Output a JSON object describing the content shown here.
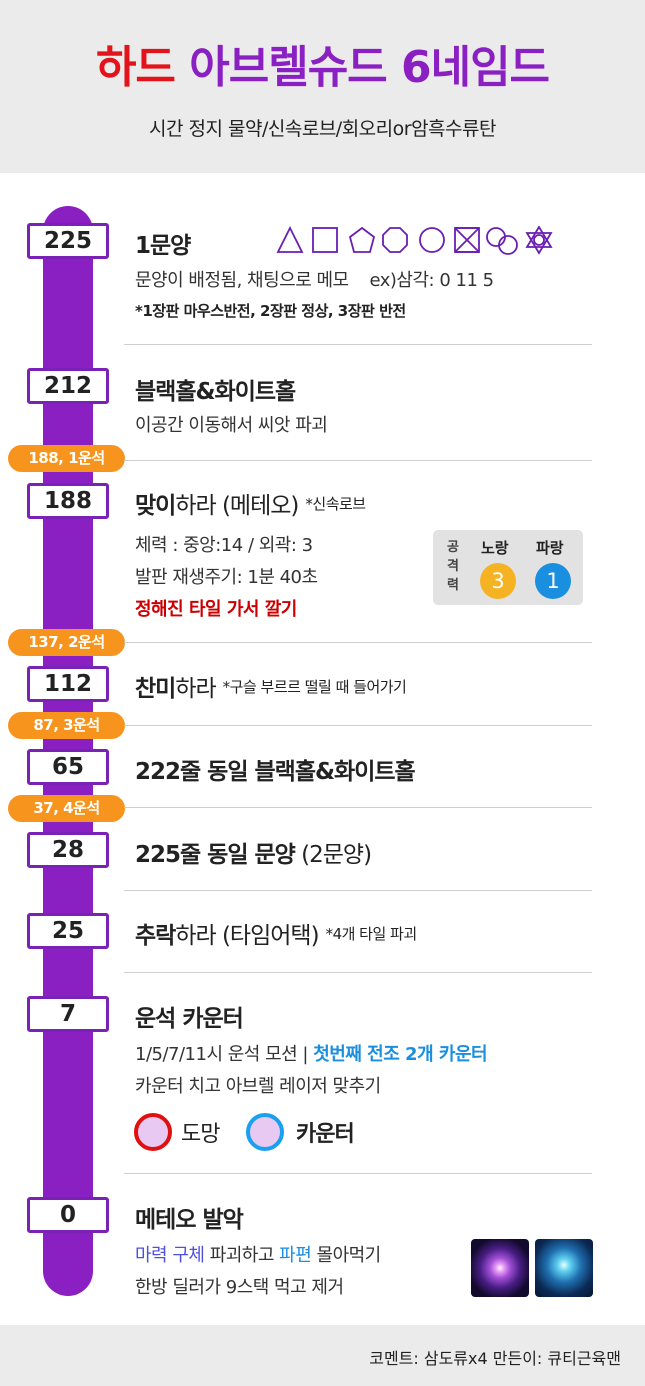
{
  "header": {
    "title_part1": "하드",
    "title_part2": "아브렐슈드 6네임드",
    "subtitle": "시간 정지 물약/신속로브/회오리or암흑수류탄"
  },
  "colors": {
    "timeline": "#8a1fc2",
    "badge": "#f7941d",
    "title_red": "#e3131b",
    "title_purple": "#8a1fc2",
    "yellow_circle": "#f5b324",
    "blue_circle": "#1a8fe0"
  },
  "timeline": [
    {
      "num": "225",
      "badge": ""
    },
    {
      "num": "212",
      "badge": ""
    },
    {
      "num": "188",
      "badge": "188, 1운석"
    },
    {
      "num": "112",
      "badge": "137, 2운석"
    },
    {
      "num": "65",
      "badge": "87, 3운석"
    },
    {
      "num": "28",
      "badge": "37, 4운석"
    },
    {
      "num": "25",
      "badge": ""
    },
    {
      "num": "7",
      "badge": ""
    },
    {
      "num": "0",
      "badge": ""
    }
  ],
  "patterns": {
    "title": "1문양",
    "shape_icons": [
      "triangle-icon",
      "square-icon",
      "pentagon-icon",
      "octagon-icon",
      "circle-icon",
      "hourglass-icon",
      "double-circle-icon",
      "hexagram-icon"
    ],
    "desc": "문양이 배정됨, 채팅으로 메모",
    "example": "ex)삼각: 0 11 5",
    "note": "*1장판 마우스반전, 2장판 정상, 3장판 반전"
  },
  "blackhole": {
    "title": "블랙홀&화이트홀",
    "desc": "이공간 이동해서 씨앗 파괴"
  },
  "meteor": {
    "title_bold": "맞이",
    "title_rest": "하라 (메테오)",
    "note": "*신속로브",
    "hp": "체력 : 중앙:14  /  외곽: 3",
    "regen": "발판 재생주기: 1분 40초",
    "warning": "정해진 타일 가서 깔기",
    "panel_side": [
      "공",
      "격",
      "력"
    ],
    "yellow_label": "노랑",
    "yellow_value": "3",
    "blue_label": "파랑",
    "blue_value": "1"
  },
  "chanmi": {
    "title_bold": "찬미",
    "title_rest": "하라",
    "note": "*구슬 부르르 떨릴 때 들어가기"
  },
  "line222": {
    "title": "222줄 동일 블랙홀&화이트홀"
  },
  "line225": {
    "title_bold": "225줄 동일 문양",
    "title_rest": " (2문양)"
  },
  "fall": {
    "title_bold": "추락",
    "title_rest": "하라 (타임어택)",
    "note": "*4개 타일 파괴"
  },
  "counter": {
    "title": "운석 카운터",
    "line1_plain": "1/5/7/11시 운석 모션 | ",
    "line1_blue": "첫번째 전조 2개 카운터",
    "line2": "카운터 치고 아브렐 레이저 맞추기",
    "legend_red": "도망",
    "legend_blue": "카운터"
  },
  "meteor_release": {
    "title": "메테오 발악",
    "line1_a": "마력 구체",
    "line1_b": " 파괴하고 ",
    "line1_c": "파편",
    "line1_d": " 몰아먹기",
    "line2": "한방 딜러가 9스택 먹고 제거"
  },
  "footer": {
    "text": "코멘트: 삼도류x4   만든이: 큐티근육맨"
  }
}
